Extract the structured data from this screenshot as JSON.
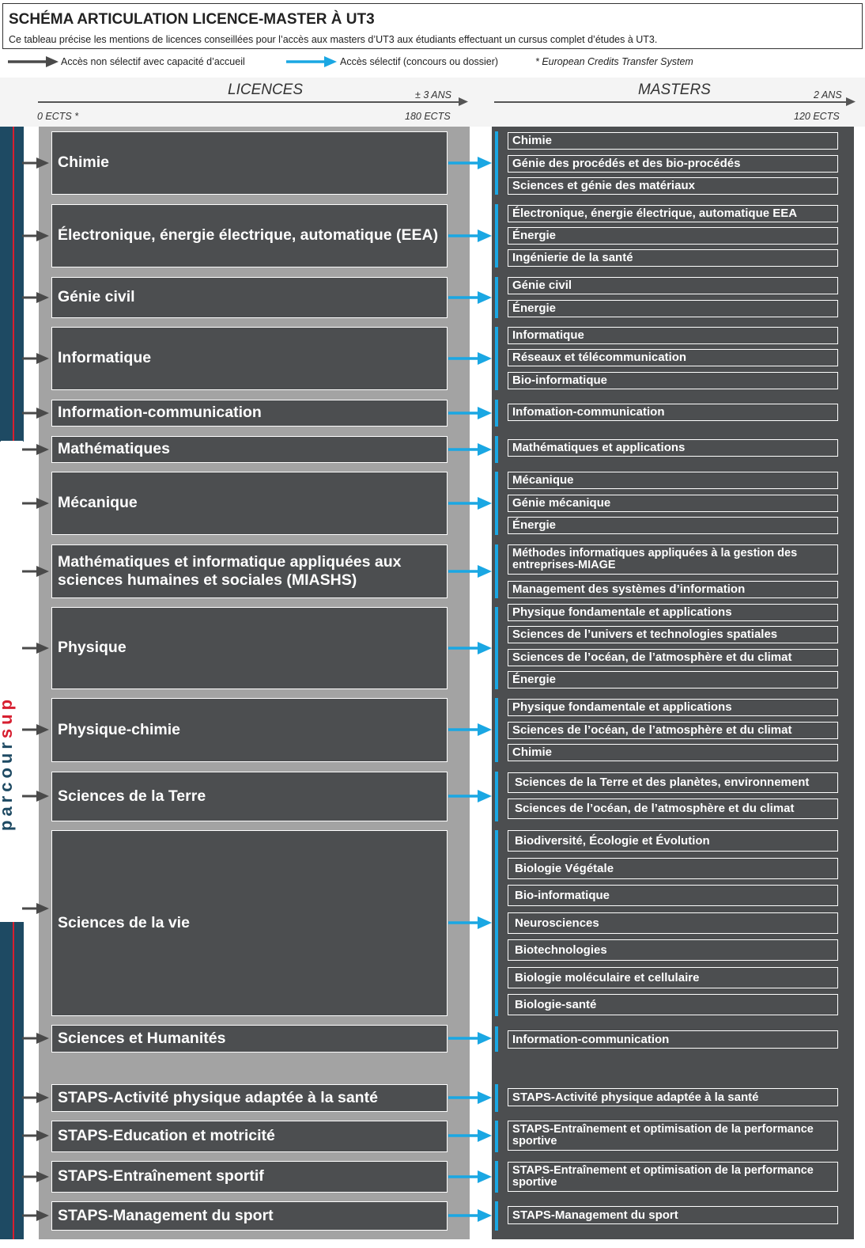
{
  "header": {
    "title": "SCHÉMA ARTICULATION LICENCE-MASTER À UT3",
    "subtitle": "Ce tableau précise les mentions de licences conseillées pour l’accès aux masters d’UT3 aux étudiants effectuant un cursus complet d’études à UT3."
  },
  "legend": {
    "non_selective": "Accès non sélectif avec capacité d’accueil",
    "selective": "Accès sélectif (concours ou dossier)",
    "ects_note": "* European Credits Transfer System"
  },
  "columns": {
    "licences": {
      "title": "LICENCES",
      "duration": "± 3 ANS",
      "start": "0 ECTS *",
      "end": "180 ECTS"
    },
    "masters": {
      "title": "MASTERS",
      "duration": "2 ANS",
      "end": "120 ECTS"
    }
  },
  "parcoursup": {
    "part1": "parcour",
    "part2": "sup"
  },
  "colors": {
    "dark_box": "#4c4e50",
    "blue_arrow": "#1aa7e3",
    "gray_arrow": "#4a4a4a",
    "side_bar": "#1e4a63",
    "side_line": "#d71f30",
    "column_bg": "#a3a3a3"
  },
  "licences": [
    {
      "label": "Chimie",
      "masters": [
        "Chimie",
        "Génie des procédés et des bio-procédés",
        "Sciences et génie des matériaux"
      ]
    },
    {
      "label": "Électronique, énergie électrique, automatique (EEA)",
      "masters": [
        "Électronique, énergie électrique, automatique EEA",
        "Énergie",
        "Ingénierie de la santé"
      ]
    },
    {
      "label": "Génie civil",
      "masters": [
        "Génie civil",
        "Énergie"
      ]
    },
    {
      "label": "Informatique",
      "masters": [
        "Informatique",
        "Réseaux et télécommunication",
        "Bio-informatique"
      ]
    },
    {
      "label": "Information-communication",
      "masters": [
        "Infomation-communication"
      ]
    },
    {
      "label": "Mathématiques",
      "masters": [
        "Mathématiques et applications"
      ]
    },
    {
      "label": "Mécanique",
      "masters": [
        "Mécanique",
        "Génie mécanique",
        "Énergie"
      ]
    },
    {
      "label": "Mathématiques et informatique appliquées aux sciences humaines et sociales (MIASHS)",
      "masters": [
        "Méthodes informatiques appliquées à la gestion des entreprises-MIAGE",
        "Management des systèmes d’information"
      ]
    },
    {
      "label": "Physique",
      "masters": [
        "Physique fondamentale et applications",
        "Sciences de l’univers et technologies spatiales",
        "Sciences de l’océan, de l’atmosphère et du climat",
        "Énergie"
      ]
    },
    {
      "label": "Physique-chimie",
      "masters": [
        "Physique fondamentale et applications",
        "Sciences de l’océan, de l’atmosphère et du climat",
        "Chimie"
      ]
    },
    {
      "label": "Sciences de la Terre",
      "masters": [
        "Sciences de la Terre et des planètes, environnement",
        "Sciences de l’océan, de l’atmosphère et du climat"
      ]
    },
    {
      "label": "Sciences de la vie",
      "masters": [
        "Biodiversité, Écologie et Évolution",
        "Biologie Végétale",
        "Bio-informatique",
        "Neurosciences",
        "Biotechnologies",
        "Biologie moléculaire et cellulaire",
        "Biologie-santé"
      ]
    },
    {
      "label": "Sciences et Humanités",
      "masters": [
        "Information-communication"
      ]
    },
    {
      "label": "STAPS-Activité physique adaptée à la santé",
      "masters": [
        "STAPS-Activité physique adaptée à la santé"
      ]
    },
    {
      "label": "STAPS-Education et motricité",
      "masters": [
        "STAPS-Entraînement et optimisation de la performance sportive"
      ]
    },
    {
      "label": "STAPS-Entraînement sportif",
      "masters": [
        "STAPS-Entraînement et optimisation de la performance sportive"
      ]
    },
    {
      "label": "STAPS-Management du sport",
      "masters": [
        "STAPS-Management du sport"
      ]
    }
  ]
}
